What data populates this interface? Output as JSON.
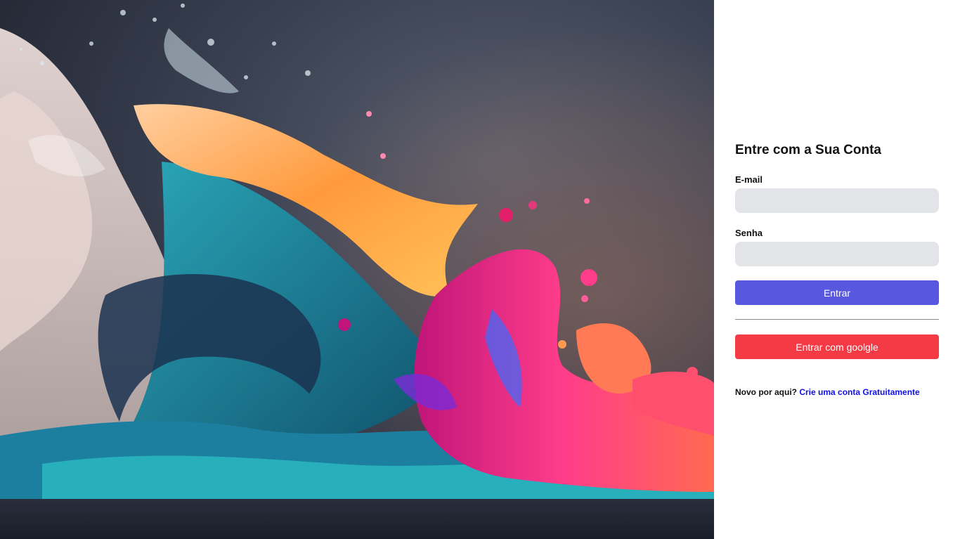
{
  "hero": {
    "image_description_icon": "paint-splash-image"
  },
  "login": {
    "title": "Entre com a Sua Conta",
    "email_label": "E-mail",
    "email_value": "",
    "password_label": "Senha",
    "password_value": "",
    "submit_label": "Entrar",
    "google_label": "Entrar com goolgle",
    "signup_prompt": "Novo por aqui?",
    "signup_link": "Crie uma conta Gratuitamente"
  },
  "colors": {
    "primary_button": "#5757e0",
    "google_button": "#f33a45",
    "input_background": "#e3e4e8",
    "link": "#1010e6"
  }
}
